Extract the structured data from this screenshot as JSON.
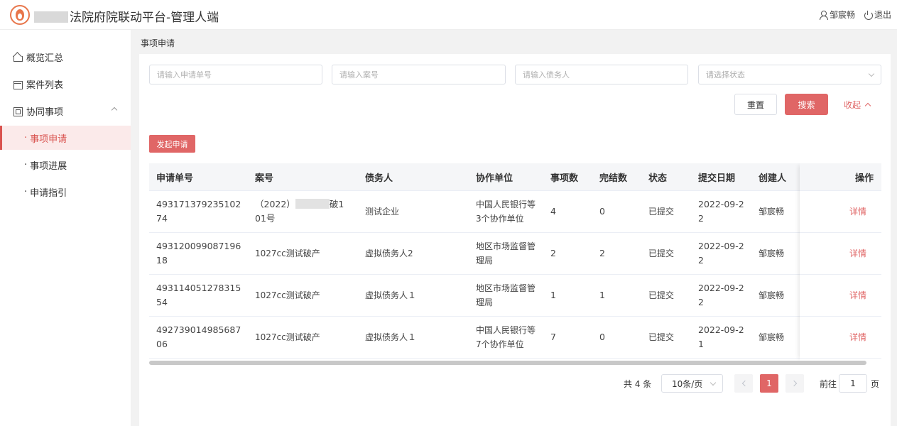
{
  "header": {
    "title": "法院府院联动平台-管理人端",
    "user_name": "邹宸畅",
    "logout_label": "退出"
  },
  "sidebar": {
    "items": [
      {
        "label": "概览汇总",
        "icon": "home-icon"
      },
      {
        "label": "案件列表",
        "icon": "calendar-icon"
      },
      {
        "label": "协同事项",
        "icon": "document-icon"
      }
    ],
    "sub_items": [
      {
        "label": "事项申请",
        "active": true
      },
      {
        "label": "事项进展",
        "active": false
      },
      {
        "label": "申请指引",
        "active": false
      }
    ]
  },
  "page": {
    "heading": "事项申请"
  },
  "filters": {
    "application_no_placeholder": "请输入申请单号",
    "case_no_placeholder": "请输入案号",
    "debtor_placeholder": "请输入债务人",
    "status_placeholder": "请选择状态",
    "reset_label": "重置",
    "search_label": "搜索",
    "collapse_label": "收起"
  },
  "actions": {
    "apply_label": "发起申请"
  },
  "table": {
    "columns": [
      "申请单号",
      "案号",
      "债务人",
      "协作单位",
      "事项数",
      "完结数",
      "状态",
      "提交日期",
      "创建人",
      "操作"
    ],
    "rows": [
      {
        "app_no": "49317137923510274",
        "case_prefix": "（2022）",
        "case_suffix": "破101号",
        "debtor": "测试企业",
        "unit": "中国人民银行等3个协作单位",
        "items": "4",
        "done": "0",
        "status": "已提交",
        "date": "2022-09-22",
        "creator": "邹宸畅",
        "action": "详情"
      },
      {
        "app_no": "49312009908719618",
        "case_no": "1027cc测试破产",
        "debtor": "虚拟债务人2",
        "unit": "地区市场监督管理局",
        "items": "2",
        "done": "2",
        "status": "已提交",
        "date": "2022-09-22",
        "creator": "邹宸畅",
        "action": "详情"
      },
      {
        "app_no": "49311405127831554",
        "case_no": "1027cc测试破产",
        "debtor": "虚拟债务人１",
        "unit": "地区市场监督管理局",
        "items": "1",
        "done": "1",
        "status": "已提交",
        "date": "2022-09-22",
        "creator": "邹宸畅",
        "action": "详情"
      },
      {
        "app_no": "49273901498568706",
        "case_no": "1027cc测试破产",
        "debtor": "虚拟债务人１",
        "unit": "中国人民银行等7个协作单位",
        "items": "7",
        "done": "0",
        "status": "已提交",
        "date": "2022-09-21",
        "creator": "邹宸畅",
        "action": "详情"
      }
    ]
  },
  "pagination": {
    "total_label": "共 4 条",
    "page_size_label": "10条/页",
    "current_page": "1",
    "jump_label": "前往",
    "jump_value": "1",
    "page_suffix": "页"
  },
  "colors": {
    "accent": "#e06666",
    "logo": "#e8764b"
  }
}
